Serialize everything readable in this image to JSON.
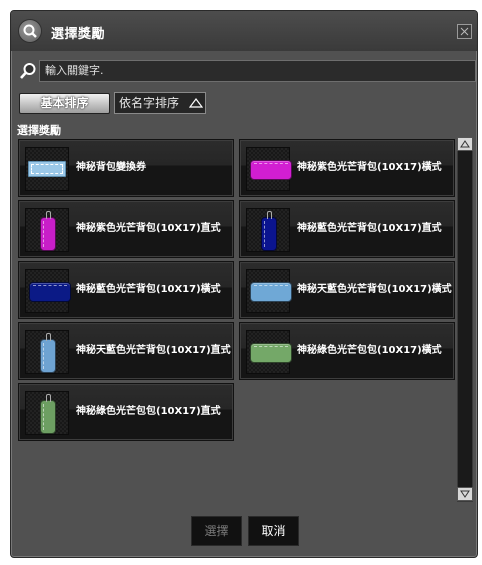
{
  "window": {
    "title": "選擇獎勵",
    "title_icon": "search-magnifier-icon",
    "close_icon": "close-icon"
  },
  "search": {
    "placeholder": "輸入關鍵字.",
    "icon": "search-icon"
  },
  "sort": {
    "basic_label": "基本排序",
    "name_label": "依名字排序",
    "name_arrow_icon": "triangle-up-icon"
  },
  "section_label": "選擇獎勵",
  "items": [
    {
      "label": "神秘背包變換券",
      "icon": "voucher-icon",
      "color": "#9bc8e8"
    },
    {
      "label": "神秘紫色光芒背包(10X17)橫式",
      "icon": "bag-horizontal-icon",
      "color": "#d21ed2"
    },
    {
      "label": "神秘紫色光芒背包(10X17)直式",
      "icon": "bag-vertical-icon",
      "color": "#c81ec8"
    },
    {
      "label": "神秘藍色光芒背包(10X17)直式",
      "icon": "bag-vertical-icon",
      "color": "#0b148f"
    },
    {
      "label": "神秘藍色光芒背包(10X17)橫式",
      "icon": "bag-horizontal-icon",
      "color": "#0b1a86"
    },
    {
      "label": "神秘天藍色光芒背包(10X17)橫式",
      "icon": "bag-horizontal-icon",
      "color": "#6fa8d6"
    },
    {
      "label": "神秘天藍色光芒背包(10X17)直式",
      "icon": "bag-vertical-icon",
      "color": "#6ea3d2"
    },
    {
      "label": "神秘綠色光芒包包(10X17)橫式",
      "icon": "bag-horizontal-icon",
      "color": "#74a868"
    },
    {
      "label": "神秘綠色光芒包包(10X17)直式",
      "icon": "bag-vertical-icon",
      "color": "#6d9f62"
    }
  ],
  "buttons": {
    "select": "選擇",
    "cancel": "取消"
  }
}
